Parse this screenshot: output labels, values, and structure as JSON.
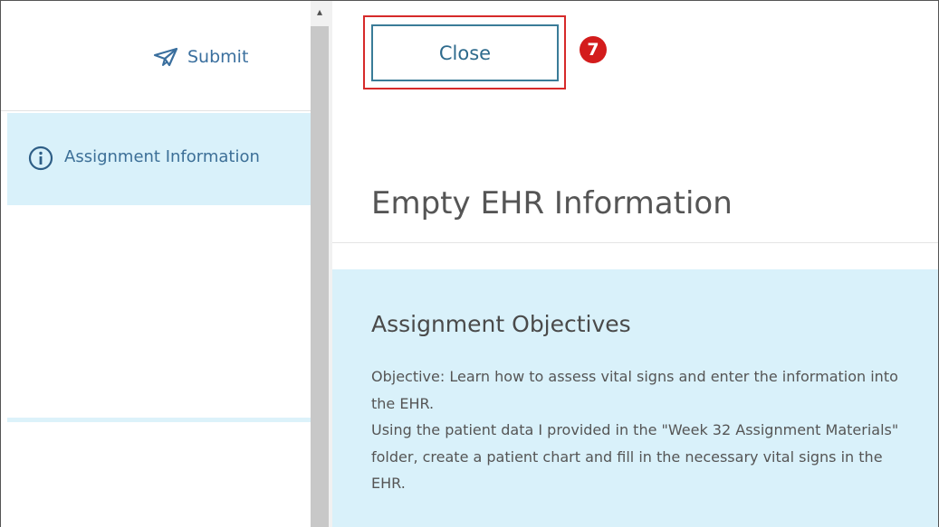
{
  "sidebar": {
    "submit_label": "Submit",
    "nav_items": [
      {
        "label": "Assignment Information",
        "icon": "info-icon",
        "active": true
      }
    ]
  },
  "toolbar": {
    "close_label": "Close",
    "step_badge": "7"
  },
  "main": {
    "page_title": "Empty EHR Information",
    "objectives": {
      "heading": "Assignment Objectives",
      "paragraphs": [
        "Objective: Learn how to assess vital signs and enter the information into the EHR.",
        "Using the patient data I provided in the \"Week 32 Assignment Materials\" folder, create a patient chart and fill in the necessary vital signs in the EHR."
      ]
    }
  },
  "colors": {
    "accent_blue": "#3a6f9e",
    "panel_bg": "#d9f1fa",
    "highlight_red": "#d62a2a"
  }
}
